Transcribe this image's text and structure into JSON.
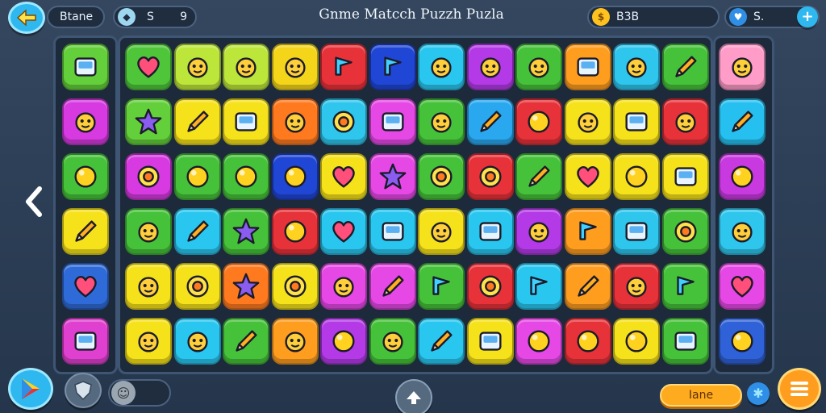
{
  "topbar": {
    "back_icon": "back-arrow-icon",
    "stage_label": "Btane",
    "stat_a": {
      "icon": "gem-icon",
      "value": "S"
    },
    "stat_b": {
      "value": "9"
    },
    "title": "Gnme Matcch Puzzh Puzla",
    "coins": {
      "icon": "coin-icon",
      "value": "B3B"
    },
    "lives": {
      "icon": "heart-badge-icon",
      "value": "S."
    },
    "add_icon": "plus-icon"
  },
  "colors": {
    "accent": "#ffb020",
    "cyan": "#29c7f0",
    "panel": "#1d2a3b"
  },
  "board": {
    "left_column": [
      {
        "color": "#63cf3a",
        "icon": "screen-icon"
      },
      {
        "color": "#d63ae0",
        "icon": "block-face-icon"
      },
      {
        "color": "#46c23a",
        "icon": "ball-icon"
      },
      {
        "color": "#f6e21a",
        "icon": "pencil-icon"
      },
      {
        "color": "#2f6bd8",
        "icon": "heart-icon"
      },
      {
        "color": "#e040d0",
        "icon": "gift-box-icon"
      }
    ],
    "right_column": [
      {
        "color": "#ff9cc8",
        "icon": "peach-icon"
      },
      {
        "color": "#25c0f0",
        "icon": "hammer-icon"
      },
      {
        "color": "#c83ae0",
        "icon": "ball-icon"
      },
      {
        "color": "#2fc6ee",
        "icon": "robot-icon"
      },
      {
        "color": "#e648e6",
        "icon": "heart-icon"
      },
      {
        "color": "#2f62d8",
        "icon": "balloon-icon"
      }
    ],
    "grid": [
      [
        {
          "color": "#4fc63a",
          "icon": "heart-icon"
        },
        {
          "color": "#bde63a",
          "icon": "fish-icon"
        },
        {
          "color": "#bde63a",
          "icon": "cloud-icon"
        },
        {
          "color": "#f5d51a",
          "icon": "face-icon"
        },
        {
          "color": "#e8323a",
          "icon": "leaf-icon"
        },
        {
          "color": "#2046d6",
          "icon": "flag-icon"
        },
        {
          "color": "#29c7f0",
          "icon": "cloud-icon"
        },
        {
          "color": "#b43ae8",
          "icon": "gem-icon"
        },
        {
          "color": "#46c23a",
          "icon": "gem-icon"
        },
        {
          "color": "#ff9d1f",
          "icon": "keyboard-icon"
        },
        {
          "color": "#2fc6ee",
          "icon": "face-icon"
        },
        {
          "color": "#46c23a",
          "icon": "pencil-icon"
        }
      ],
      [
        {
          "color": "#63cf3a",
          "icon": "star-icon"
        },
        {
          "color": "#f6e21a",
          "icon": "pin-icon"
        },
        {
          "color": "#f6e21a",
          "icon": "monitor-icon"
        },
        {
          "color": "#ff7a1f",
          "icon": "snake-icon"
        },
        {
          "color": "#2fc6ee",
          "icon": "target-icon"
        },
        {
          "color": "#e648e6",
          "icon": "window-icon"
        },
        {
          "color": "#46c23a",
          "icon": "creature-icon"
        },
        {
          "color": "#29a8f0",
          "icon": "pencil-icon"
        },
        {
          "color": "#e8323a",
          "icon": "ball-icon"
        },
        {
          "color": "#f6e21a",
          "icon": "bug-icon"
        },
        {
          "color": "#f6e21a",
          "icon": "card-icon"
        },
        {
          "color": "#e8323a",
          "icon": "robot-icon"
        }
      ],
      [
        {
          "color": "#d63ae0",
          "icon": "sun-icon"
        },
        {
          "color": "#46c23a",
          "icon": "blob-icon"
        },
        {
          "color": "#46c23a",
          "icon": "blob-icon"
        },
        {
          "color": "#2046d6",
          "icon": "ball-icon"
        },
        {
          "color": "#f6e21a",
          "icon": "heart-icon"
        },
        {
          "color": "#e648e6",
          "icon": "star-icon"
        },
        {
          "color": "#46c23a",
          "icon": "flower-icon"
        },
        {
          "color": "#e8323a",
          "icon": "sun-icon"
        },
        {
          "color": "#46c23a",
          "icon": "pencil-icon"
        },
        {
          "color": "#f6e21a",
          "icon": "heart-icon"
        },
        {
          "color": "#f6e21a",
          "icon": "egg-icon"
        },
        {
          "color": "#f6e21a",
          "icon": "calculator-icon"
        }
      ],
      [
        {
          "color": "#46c23a",
          "icon": "cat-icon"
        },
        {
          "color": "#29c7f0",
          "icon": "cone-icon"
        },
        {
          "color": "#46c23a",
          "icon": "star-icon"
        },
        {
          "color": "#e8323a",
          "icon": "blob-icon"
        },
        {
          "color": "#29c7f0",
          "icon": "heart-icon"
        },
        {
          "color": "#29c7f0",
          "icon": "car-icon"
        },
        {
          "color": "#f6e21a",
          "icon": "dog-icon"
        },
        {
          "color": "#29c7f0",
          "icon": "square-icon"
        },
        {
          "color": "#b43ae8",
          "icon": "person-icon"
        },
        {
          "color": "#ff9d1f",
          "icon": "speaker-icon"
        },
        {
          "color": "#2fc6ee",
          "icon": "battery-icon"
        },
        {
          "color": "#46c23a",
          "icon": "flower-icon"
        }
      ],
      [
        {
          "color": "#f6e21a",
          "icon": "bird-icon"
        },
        {
          "color": "#f6e21a",
          "icon": "donut-icon"
        },
        {
          "color": "#ff7a1f",
          "icon": "sparkle-icon"
        },
        {
          "color": "#f6e21a",
          "icon": "spiral-icon"
        },
        {
          "color": "#e648e6",
          "icon": "skull-icon"
        },
        {
          "color": "#e648e6",
          "icon": "cone-icon"
        },
        {
          "color": "#46c23a",
          "icon": "bell-icon"
        },
        {
          "color": "#e8323a",
          "icon": "magnifier-icon"
        },
        {
          "color": "#29c7f0",
          "icon": "arrow-icon"
        },
        {
          "color": "#ff9d1f",
          "icon": "marker-icon"
        },
        {
          "color": "#e8323a",
          "icon": "bird-icon"
        },
        {
          "color": "#46c23a",
          "icon": "music-icon"
        }
      ],
      [
        {
          "color": "#f6e21a",
          "icon": "fish-icon"
        },
        {
          "color": "#29c7f0",
          "icon": "fish-icon"
        },
        {
          "color": "#46c23a",
          "icon": "chili-icon"
        },
        {
          "color": "#ff9d1f",
          "icon": "frog-icon"
        },
        {
          "color": "#b43ae8",
          "icon": "ball-icon"
        },
        {
          "color": "#46c23a",
          "icon": "creature-icon"
        },
        {
          "color": "#29c7f0",
          "icon": "pickle-icon"
        },
        {
          "color": "#f6e21a",
          "icon": "radio-icon"
        },
        {
          "color": "#e648e6",
          "icon": "globe-icon"
        },
        {
          "color": "#e8323a",
          "icon": "ball-icon"
        },
        {
          "color": "#f6e21a",
          "icon": "bomb-icon"
        },
        {
          "color": "#46c23a",
          "icon": "book-icon"
        }
      ]
    ]
  },
  "bottom": {
    "play_icon": "play-store-icon",
    "shield_icon": "shield-icon",
    "avatar_icon": "face-icon",
    "up_icon": "up-arrow-icon",
    "action_label": "Iane",
    "settings_icon": "gear-icon",
    "menu_icon": "menu-icon"
  }
}
